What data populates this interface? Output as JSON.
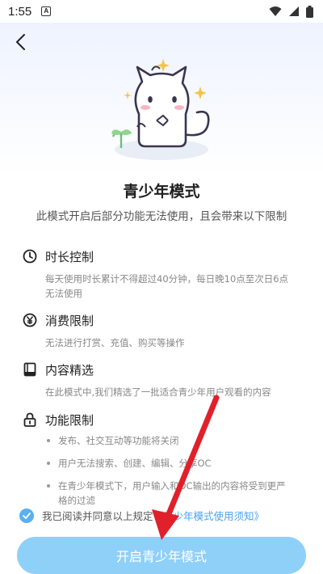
{
  "status_bar": {
    "time": "1:55",
    "notification_icon_letter": "A"
  },
  "header": {
    "back_icon": "back-chevron-icon"
  },
  "page": {
    "title": "青少年模式",
    "subtitle": "此模式开启后部分功能无法使用，且会带来以下限制"
  },
  "sections": [
    {
      "icon": "clock-icon",
      "title": "时长控制",
      "desc": [
        "每天使用时长累计不得超过40分钟，每日晚10点至次日6点",
        "无法使用"
      ]
    },
    {
      "icon": "yen-icon",
      "title": "消费限制",
      "desc": [
        "无法进行打赏、充值、购买等操作"
      ]
    },
    {
      "icon": "book-icon",
      "title": "内容精选",
      "desc": [
        "在此模式中,我们精选了一批适合青少年用户观看的内容"
      ]
    },
    {
      "icon": "lock-icon",
      "title": "功能限制",
      "bullets": [
        "发布、社交互动等功能将关闭",
        "用户无法搜索、创建、编辑、分享OC",
        "在青少年模式下，用户输入和OC输出的内容将受到更严",
        "格的过滤"
      ]
    }
  ],
  "agreement": {
    "text": "我已阅读并同意以上规定",
    "link": "《青少年模式使用须知》",
    "checked": true
  },
  "primary_button": {
    "label": "开启青少年模式"
  },
  "colors": {
    "accent": "#5ab0f0",
    "button": "#8fd0f8",
    "arrow": "#e0202a"
  }
}
